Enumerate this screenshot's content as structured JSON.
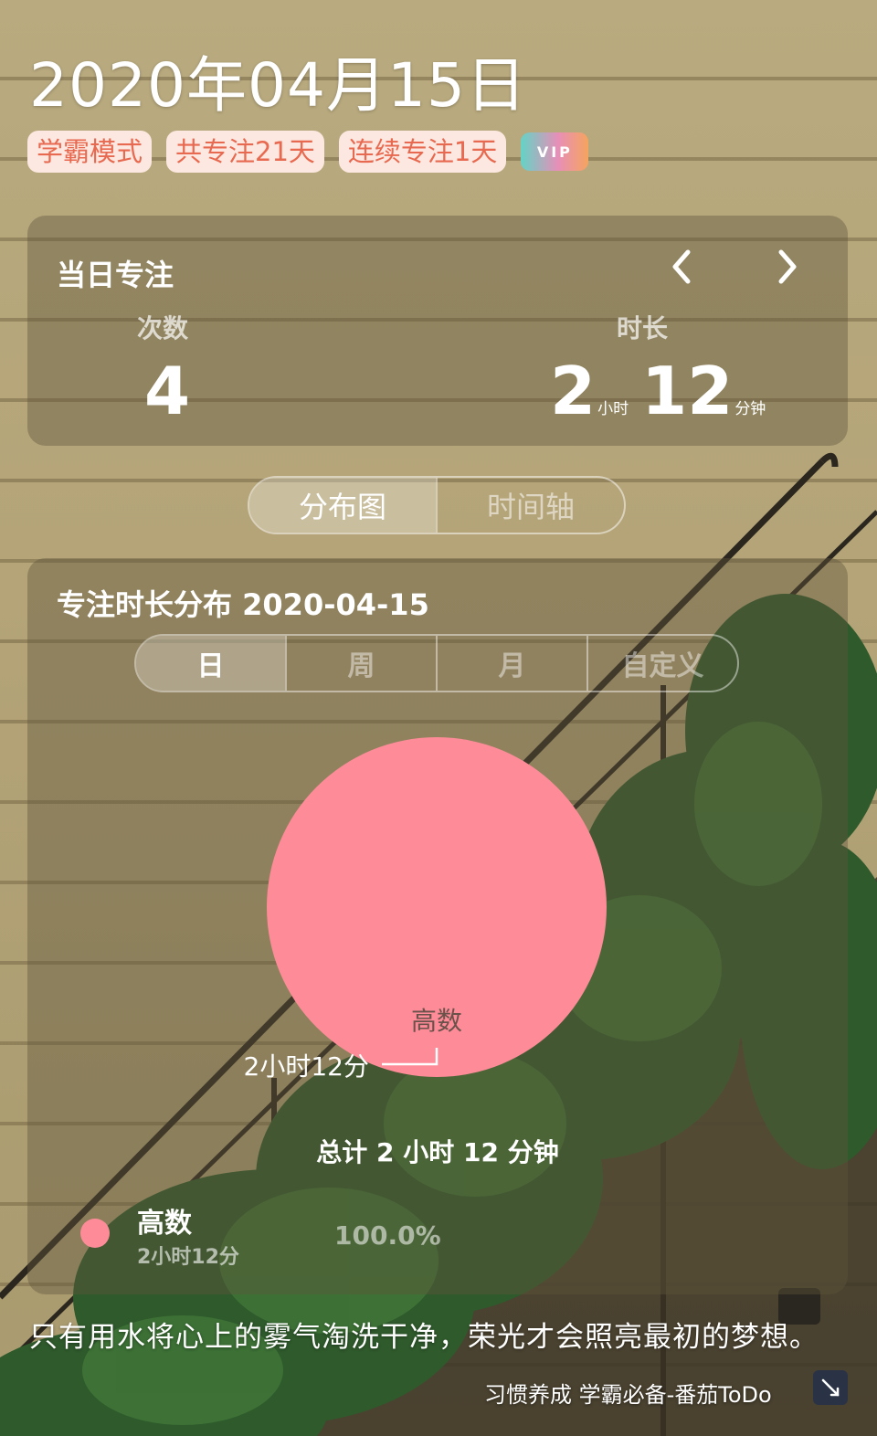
{
  "header": {
    "date": "2020年04月15日",
    "tags": [
      "学霸模式",
      "共专注21天",
      "连续专注1天"
    ],
    "vip_label": "VIP"
  },
  "daily_focus": {
    "title": "当日专注",
    "prev_icon": "chevron-left-icon",
    "next_icon": "chevron-right-icon",
    "count_label": "次数",
    "count_value": "4",
    "duration_label": "时长",
    "hours_value": "2",
    "hours_unit": "小时",
    "minutes_value": "12",
    "minutes_unit": "分钟"
  },
  "view_toggle": {
    "items": [
      "分布图",
      "时间轴"
    ],
    "active": "分布图"
  },
  "distribution": {
    "title": "专注时长分布  2020-04-15",
    "range_tabs": [
      "日",
      "周",
      "月",
      "自定义"
    ],
    "active_range": "日",
    "total": "总计 2 小时 12 分钟",
    "legend": [
      {
        "name": "高数",
        "duration": "2小时12分",
        "percent": "100.0%",
        "color": "#fd8c98"
      }
    ]
  },
  "chart_data": {
    "type": "pie",
    "slices": [
      {
        "label": "高数",
        "value": 100.0,
        "value_label": "2小时12分",
        "color": "#fd8c98"
      }
    ]
  },
  "footer": {
    "quote": "只有用水将心上的雾气淘洗干净，荣光才会照亮最初的梦想。",
    "brand": "习惯养成 学霸必备-番茄ToDo",
    "fullscreen_icon": "expand-icon"
  }
}
